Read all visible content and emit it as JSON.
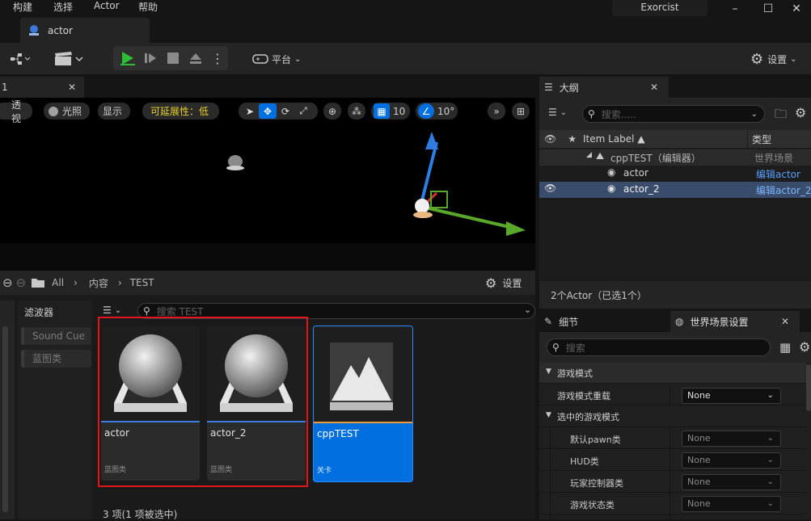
{
  "menu": {
    "items": [
      "构建",
      "选择",
      "Actor",
      "帮助"
    ]
  },
  "window": {
    "title": "Exorcist",
    "minimize": "–",
    "maximize": "☐",
    "close": "✕"
  },
  "tab": {
    "label": "actor"
  },
  "toolbar": {
    "platform_label": "平台",
    "settings_label": "设置"
  },
  "viewport": {
    "tab_label": "1",
    "perspective": "透视",
    "lit": "光照",
    "show": "显示",
    "scalability": "可延展性：低",
    "grid_snap": "10",
    "rotation_snap": "10°"
  },
  "content_browser": {
    "breadcrumb": [
      "All",
      "内容",
      "TEST"
    ],
    "settings_label": "设置",
    "filters_title": "滤波器",
    "filters": [
      "Sound Cue",
      "蓝图类"
    ],
    "search_placeholder": "搜索 TEST",
    "assets": [
      {
        "name": "actor",
        "type": "蓝图类"
      },
      {
        "name": "actor_2",
        "type": "蓝图类"
      },
      {
        "name": "cppTEST",
        "type": "关卡"
      }
    ],
    "status": "3 项(1 项被选中)"
  },
  "outliner": {
    "tab_label": "大纲",
    "search_placeholder": "搜索.....",
    "col_item_label": "Item Label ▲",
    "col_type": "类型",
    "rows": [
      {
        "label": "cppTEST（编辑器）",
        "type": "世界场景"
      },
      {
        "label": "actor",
        "type": "编辑actor"
      },
      {
        "label": "actor_2",
        "type": "编辑actor_2"
      }
    ],
    "status": "2个Actor（已选1个）"
  },
  "details": {
    "tab_details": "细节",
    "tab_world": "世界场景设置",
    "search_placeholder": "搜索",
    "section_game_mode": "游戏模式",
    "override_label": "游戏模式重载",
    "override_value": "None",
    "section_selected": "选中的游戏模式",
    "properties": [
      {
        "label": "默认pawn类",
        "value": "None"
      },
      {
        "label": "HUD类",
        "value": "None"
      },
      {
        "label": "玩家控制器类",
        "value": "None"
      },
      {
        "label": "游戏状态类",
        "value": "None"
      }
    ]
  },
  "colors": {
    "accent_blue": "#0070e0",
    "selection_red": "#e3141a",
    "play_green": "#2fbd35",
    "highlight_yellow": "#e8d22a"
  }
}
